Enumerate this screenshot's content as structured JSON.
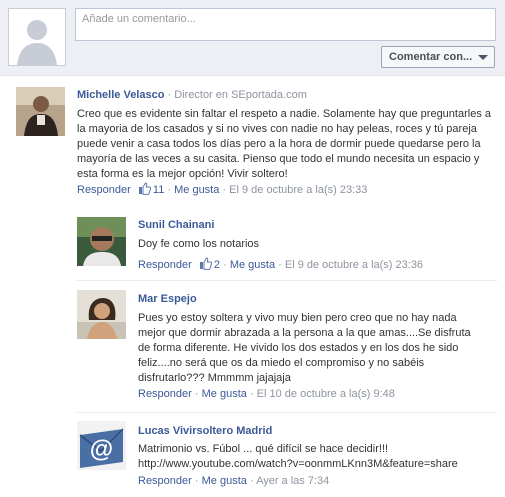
{
  "composer": {
    "placeholder": "Añade un comentario...",
    "button_label": "Comentar con..."
  },
  "comments": [
    {
      "author": "Michelle Velasco",
      "meta": " · Director en SEportada.com",
      "text": "Creo que es evidente sin faltar el respeto a nadie. Solamente hay que preguntarles a la mayoria de los casados y si no vives con nadie no hay peleas, roces y tú pareja puede venir a casa todos los días pero a la hora de dormir puede quedarse pero la mayoría de las veces a su casita. Pienso que todo el mundo necesita un espacio y esta forma es la mejor opción! Vivir soltero!",
      "reply_label": "Responder",
      "likes": "11",
      "like_label": "Me gusta",
      "timestamp": "El 9 de octubre a la(s) 23:33"
    },
    {
      "author": "Sunil Chainani",
      "text": "Doy fe como los notarios",
      "reply_label": "Responder",
      "likes": "2",
      "like_label": "Me gusta",
      "timestamp": "El 9 de octubre a la(s) 23:36"
    },
    {
      "author": "Mar Espejo",
      "text": "Pues yo estoy soltera y vivo muy bien pero creo que no hay nada mejor que dormir abrazada a la persona a la que amas....Se disfruta de forma diferente. He vivido los dos estados y en los dos he sido feliz....no será que os da miedo el compromiso y no sabéis disfrutarlo??? Mmmmm jajajaja",
      "reply_label": "Responder",
      "like_label": "Me gusta",
      "timestamp": "El 10 de octubre a la(s) 9:48"
    },
    {
      "author": "Lucas Vivirsoltero Madrid",
      "text": "Matrimonio vs. Fúbol ... qué difícil se hace decidir!!! http://www.youtube.com/watch?v=oonmmLKnn3M&feature=share",
      "reply_label": "Responder",
      "like_label": "Me gusta",
      "timestamp": "Ayer a las 7:34"
    }
  ],
  "colors": {
    "link": "#3b5998",
    "composer_bg": "#edeff4",
    "meta": "#8d949e"
  }
}
